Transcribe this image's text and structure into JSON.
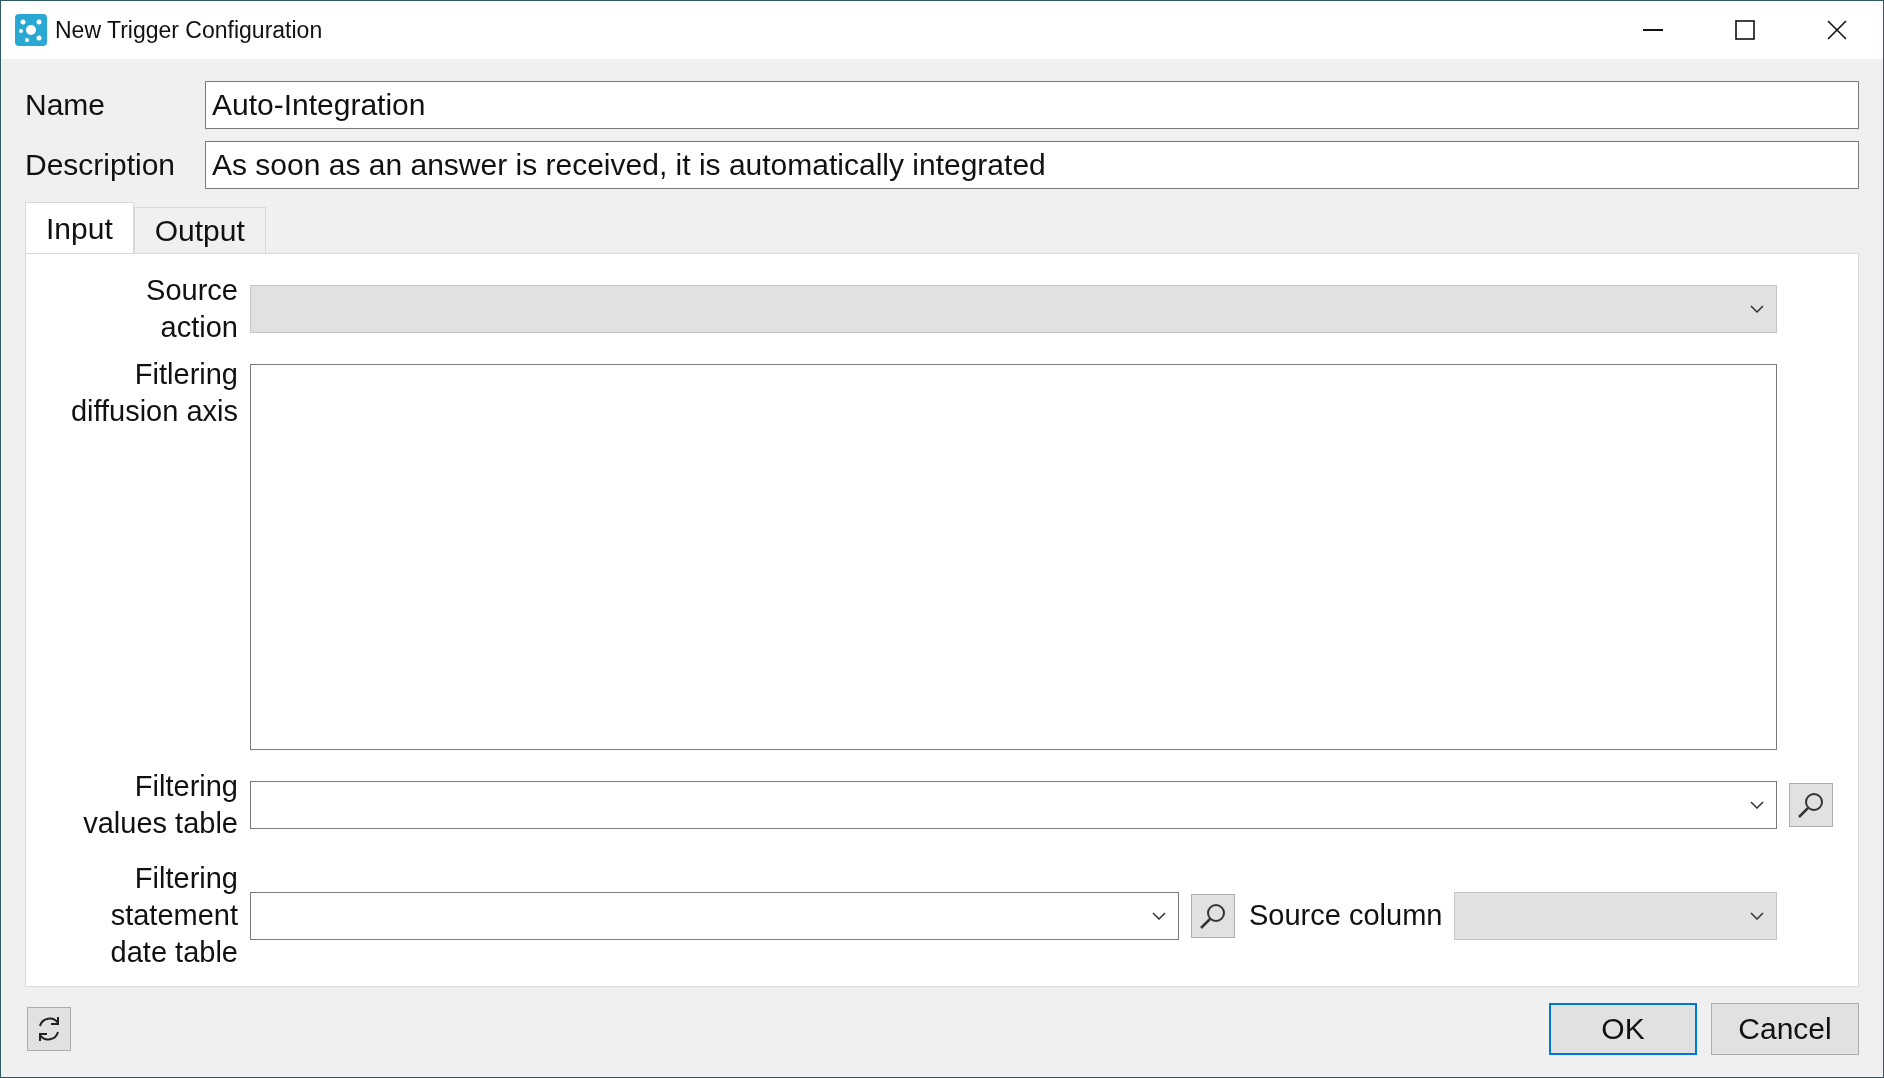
{
  "window": {
    "title": "New Trigger Configuration"
  },
  "header_fields": [
    {
      "label": "Name",
      "value": "Auto-Integration"
    },
    {
      "label": "Description",
      "value": "As soon as an answer is received, it is automatically integrated"
    }
  ],
  "tabs": [
    {
      "label": "Input",
      "selected": true
    },
    {
      "label": "Output",
      "selected": false
    }
  ],
  "input_rows": [
    {
      "kind": "combo",
      "label_lines": [
        "Source",
        "action"
      ],
      "disabled": true,
      "search": false
    },
    {
      "kind": "textarea",
      "label_lines": [
        "Fitlering",
        "diffusion axis"
      ]
    },
    {
      "kind": "combo",
      "label_lines": [
        "Filtering",
        "values table"
      ],
      "disabled": false,
      "search": true
    },
    {
      "kind": "combo-pair",
      "label_lines": [
        "Filtering",
        "statement",
        "date table"
      ],
      "disabled": false,
      "search": true,
      "secondary": {
        "label": "Source column",
        "disabled": true
      }
    }
  ],
  "buttons": [
    {
      "label": "OK",
      "default": true
    },
    {
      "label": "Cancel",
      "default": false
    }
  ]
}
